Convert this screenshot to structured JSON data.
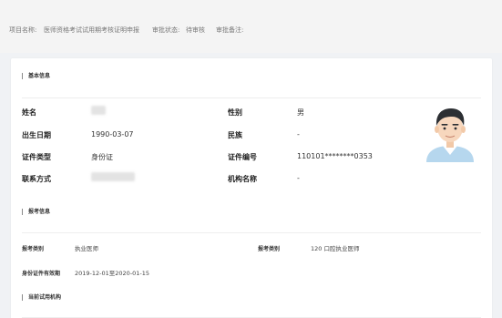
{
  "header": {
    "project_label": "项目名称:",
    "project_value": "医师资格考试试用期考核证明申报",
    "status_label": "审批状态:",
    "status_value": "待审核",
    "remark_label": "审批备注:"
  },
  "basic_info": {
    "title": "基本信息",
    "fields": {
      "name_label": "姓名",
      "gender_label": "性别",
      "gender_value": "男",
      "birth_label": "出生日期",
      "birth_value": "1990-03-07",
      "ethnicity_label": "民族",
      "ethnicity_value": "-",
      "id_type_label": "证件类型",
      "id_type_value": "身份证",
      "id_no_label": "证件编号",
      "id_no_value": "110101********0353",
      "phone_label": "联系方式",
      "org_label": "机构名称",
      "org_value": "-"
    },
    "avatar_icon": "person-avatar-icon"
  },
  "exam_info": {
    "title": "报考信息",
    "fields": {
      "category_label": "报考类别",
      "category_value": "执业医师",
      "type_label": "报考类别",
      "type_value": "120 口腔执业医师",
      "validity_label": "身份证件有效期",
      "validity_value": "2019-12-01至2020-01-15"
    }
  },
  "trial_org": {
    "title": "当前试用机构"
  },
  "colors": {
    "page_bg": "#f0f2f5",
    "card_bg": "#ffffff",
    "avatar_shirt": "#b6d7ee",
    "avatar_hair": "#2c2f33",
    "avatar_skin": "#f7d7bd"
  }
}
